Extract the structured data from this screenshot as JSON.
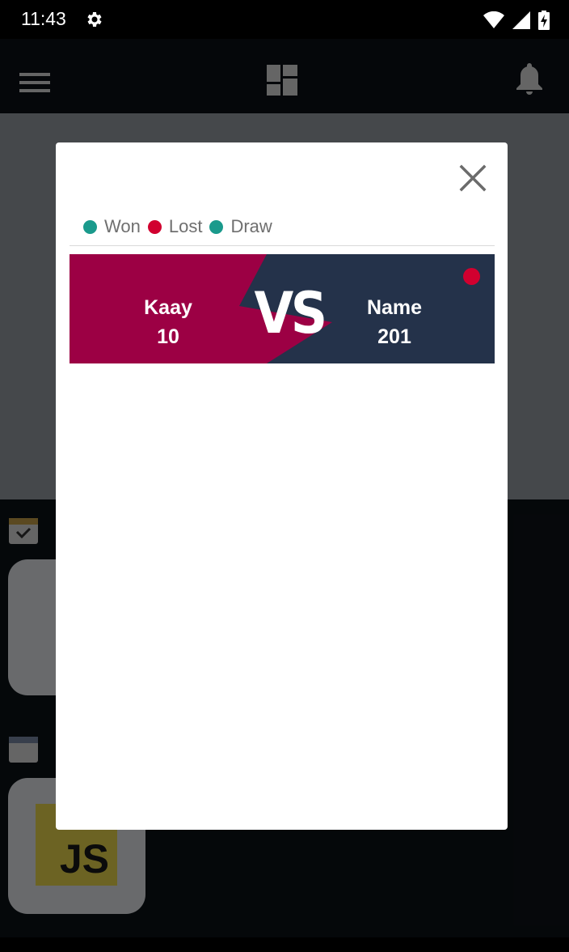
{
  "status_bar": {
    "time": "11:43"
  },
  "colors": {
    "won": "#1a9a8c",
    "lost": "#d1002f",
    "draw": "#1a9a8c",
    "left_team_bg": "#9c0044",
    "right_team_bg": "#24324a"
  },
  "legend": {
    "items": [
      {
        "label": "Won",
        "color": "#1a9a8c"
      },
      {
        "label": "Lost",
        "color": "#d1002f"
      },
      {
        "label": "Draw",
        "color": "#1a9a8c"
      }
    ]
  },
  "match": {
    "left": {
      "name": "Kaay",
      "score": "10"
    },
    "vs": "VS",
    "right": {
      "name": "Name",
      "score": "201"
    },
    "result": "lost"
  },
  "background_app": {
    "js_logo_text": "JS"
  }
}
